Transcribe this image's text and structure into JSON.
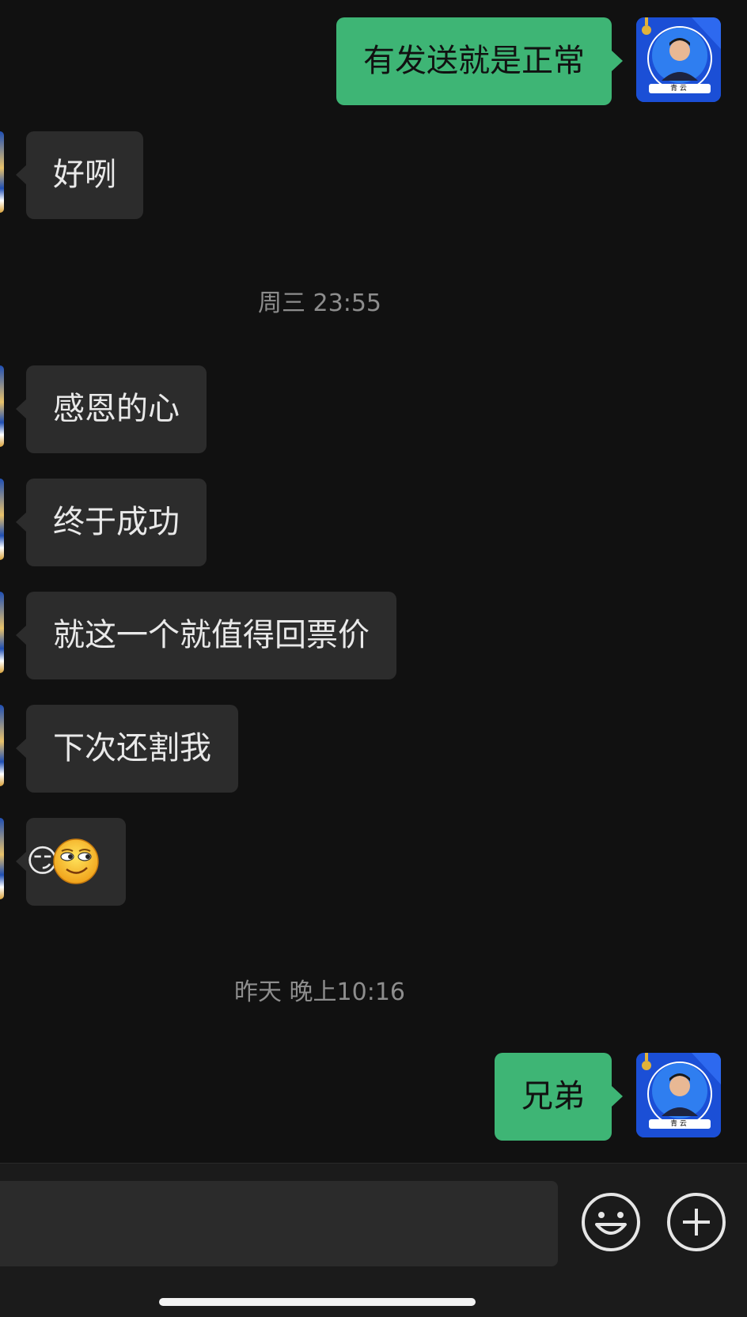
{
  "messages": [
    {
      "text": "有发送就是正常"
    },
    {
      "text": "好咧"
    },
    {
      "text": "感恩的心"
    },
    {
      "text": "终于成功"
    },
    {
      "text": "就这一个就值得回票价"
    },
    {
      "text": "下次还割我"
    },
    {
      "text": "😏"
    },
    {
      "text": "兄弟"
    }
  ],
  "timestamps": [
    "周三 23:55",
    "昨天 晚上10:16"
  ],
  "avatar": {
    "caption": "青 云",
    "icon": "user-avatar"
  },
  "input_bar": {
    "emoji_icon": "emoji-face-icon",
    "plus_icon": "plus-circle-icon"
  },
  "colors": {
    "background": "#111111",
    "outgoing_bubble": "#3eb575",
    "incoming_bubble": "#2c2c2c",
    "timestamp_text": "#8d8d8d"
  }
}
